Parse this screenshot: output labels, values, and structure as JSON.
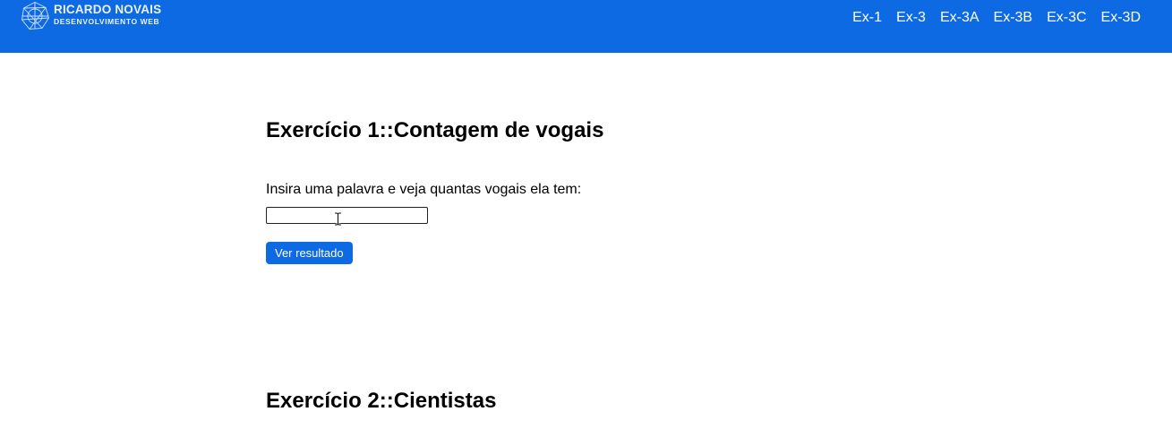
{
  "header": {
    "background_color": "#0d6ae3",
    "logo": {
      "title": "RICARDO NOVAIS",
      "subtitle": "DESENVOLVIMENTO WEB",
      "icon": "globe-icon"
    },
    "nav": {
      "items": [
        {
          "label": "Ex-1"
        },
        {
          "label": "Ex-3"
        },
        {
          "label": "Ex-3A"
        },
        {
          "label": "Ex-3B"
        },
        {
          "label": "Ex-3C"
        },
        {
          "label": "Ex-3D"
        }
      ]
    }
  },
  "main": {
    "exercise1": {
      "title": "Exercício 1::Contagem de vogais",
      "prompt": "Insira uma palavra e veja quantas vogais ela tem:",
      "input_value": "",
      "input_placeholder": "",
      "button_label": "Ver resultado",
      "button_color": "#0d6ae3"
    },
    "exercise2": {
      "title": "Exercício 2::Cientistas"
    }
  },
  "mouse_cursor": {
    "icon": "text-cursor-icon"
  }
}
